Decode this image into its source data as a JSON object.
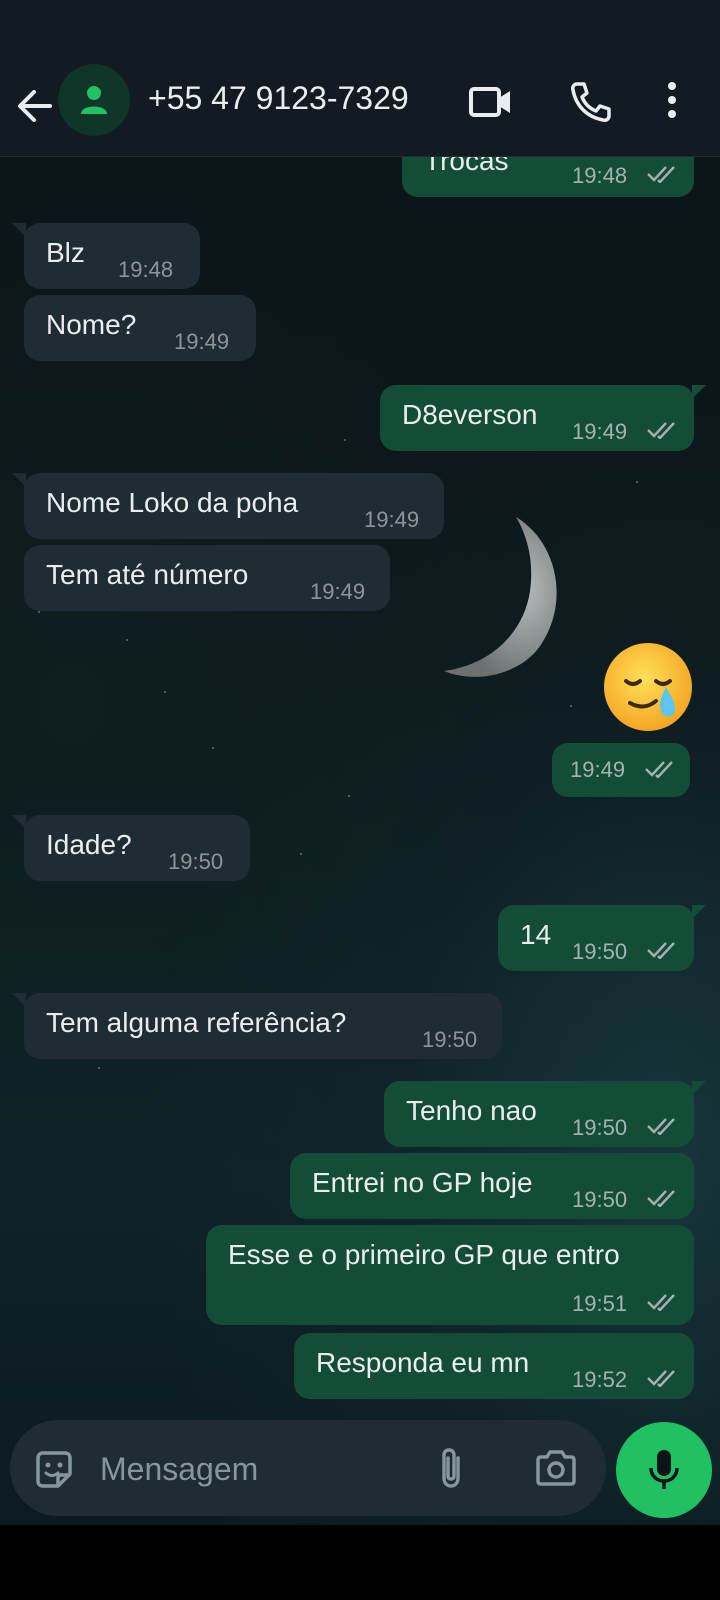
{
  "header": {
    "contact_name": "+55 47 9123-7329",
    "icons": [
      "back-arrow-icon",
      "avatar-person-icon",
      "video-call-icon",
      "phone-icon",
      "more-vert-icon"
    ]
  },
  "messages": [
    {
      "dir": "out",
      "text": "Trocas",
      "time": "19:48",
      "read": true
    },
    {
      "dir": "in",
      "text": "Blz",
      "time": "19:48"
    },
    {
      "dir": "in",
      "text": "Nome?",
      "time": "19:49"
    },
    {
      "dir": "out",
      "text": "D8everson",
      "time": "19:49",
      "read": true
    },
    {
      "dir": "in",
      "text": "Nome Loko da poha",
      "time": "19:49"
    },
    {
      "dir": "in",
      "text": "Tem até número",
      "time": "19:49"
    },
    {
      "dir": "out",
      "emoji": "crying-face-emoji",
      "time": "19:49",
      "read": true
    },
    {
      "dir": "in",
      "text": "Idade?",
      "time": "19:50"
    },
    {
      "dir": "out",
      "text": "14",
      "time": "19:50",
      "read": true
    },
    {
      "dir": "in",
      "text": "Tem alguma referência?",
      "time": "19:50"
    },
    {
      "dir": "out",
      "text": "Tenho nao",
      "time": "19:50",
      "read": true
    },
    {
      "dir": "out",
      "text": "Entrei no GP hoje",
      "time": "19:50",
      "read": true
    },
    {
      "dir": "out",
      "text": "Esse e o primeiro GP que entro",
      "time": "19:51",
      "read": true
    },
    {
      "dir": "out",
      "text": "Responda eu mn",
      "time": "19:52",
      "read": true
    }
  ],
  "composer": {
    "placeholder": "Mensagem",
    "icons": [
      "sticker-icon",
      "attach-icon",
      "camera-icon",
      "mic-icon"
    ]
  },
  "colors": {
    "header_bg": "#111b21",
    "bubble_in": "#202c33",
    "bubble_out": "#144d37",
    "mic_button": "#21c063",
    "avatar_accent": "#21c063"
  }
}
